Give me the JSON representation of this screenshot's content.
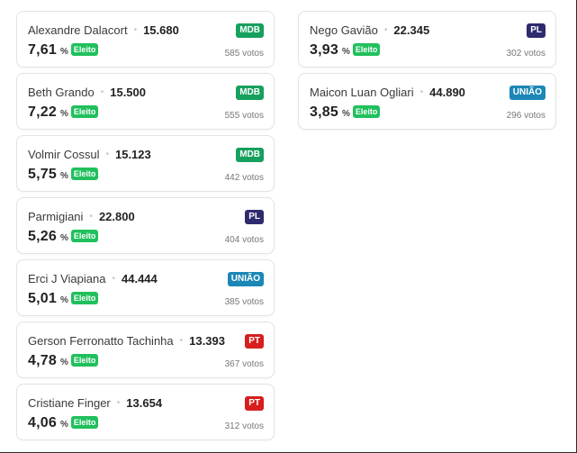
{
  "colors": {
    "eleito": "#20c05c",
    "MDB": "#16a05d",
    "PL": "#2f2b6e",
    "UNIÃO": "#1b87b6",
    "PT": "#d81e1e"
  },
  "left": [
    {
      "name": "Alexandre Dalacort",
      "number": "15.680",
      "pct": "7,61",
      "pct_sign": "%",
      "status": "Eleito",
      "party": "MDB",
      "votes": "585 votos"
    },
    {
      "name": "Beth Grando",
      "number": "15.500",
      "pct": "7,22",
      "pct_sign": "%",
      "status": "Eleito",
      "party": "MDB",
      "votes": "555 votos"
    },
    {
      "name": "Volmir Cossul",
      "number": "15.123",
      "pct": "5,75",
      "pct_sign": "%",
      "status": "Eleito",
      "party": "MDB",
      "votes": "442 votos"
    },
    {
      "name": "Parmigiani",
      "number": "22.800",
      "pct": "5,26",
      "pct_sign": "%",
      "status": "Eleito",
      "party": "PL",
      "votes": "404 votos"
    },
    {
      "name": "Erci J Viapiana",
      "number": "44.444",
      "pct": "5,01",
      "pct_sign": "%",
      "status": "Eleito",
      "party": "UNIÃO",
      "votes": "385 votos"
    },
    {
      "name": "Gerson Ferronatto Tachinha",
      "number": "13.393",
      "pct": "4,78",
      "pct_sign": "%",
      "status": "Eleito",
      "party": "PT",
      "votes": "367 votos"
    },
    {
      "name": "Cristiane Finger",
      "number": "13.654",
      "pct": "4,06",
      "pct_sign": "%",
      "status": "Eleito",
      "party": "PT",
      "votes": "312 votos"
    }
  ],
  "right": [
    {
      "name": "Nego Gavião",
      "number": "22.345",
      "pct": "3,93",
      "pct_sign": "%",
      "status": "Eleito",
      "party": "PL",
      "votes": "302 votos"
    },
    {
      "name": "Maicon Luan Ogliari",
      "number": "44.890",
      "pct": "3,85",
      "pct_sign": "%",
      "status": "Eleito",
      "party": "UNIÃO",
      "votes": "296 votos"
    }
  ]
}
